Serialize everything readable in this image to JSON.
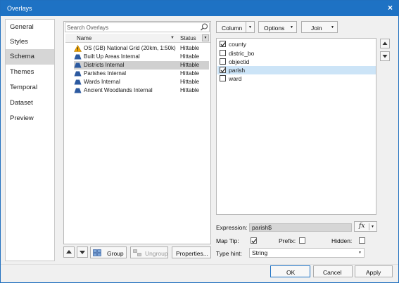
{
  "window": {
    "title": "Overlays",
    "close_glyph": "×"
  },
  "nav": [
    {
      "label": "General",
      "selected": false
    },
    {
      "label": "Styles",
      "selected": false
    },
    {
      "label": "Schema",
      "selected": true
    },
    {
      "label": "Themes",
      "selected": false
    },
    {
      "label": "Temporal",
      "selected": false
    },
    {
      "label": "Dataset",
      "selected": false
    },
    {
      "label": "Preview",
      "selected": false
    }
  ],
  "overlays": {
    "search_placeholder": "Search Overlays",
    "col_name": "Name",
    "col_status": "Status",
    "rows": [
      {
        "name": "OS (GB) National Grid (20km, 1:50k)",
        "status": "Hittable",
        "icon": "warning-icon",
        "selected": false
      },
      {
        "name": "Built Up Areas Internal",
        "status": "Hittable",
        "icon": "layer-icon",
        "selected": false
      },
      {
        "name": "Districts Internal",
        "status": "Hittable",
        "icon": "layer-icon",
        "selected": true
      },
      {
        "name": "Parishes Internal",
        "status": "Hittable",
        "icon": "layer-icon",
        "selected": false
      },
      {
        "name": "Wards Internal",
        "status": "Hittable",
        "icon": "layer-icon",
        "selected": false
      },
      {
        "name": "Ancient Woodlands Internal",
        "status": "Hittable",
        "icon": "layer-icon",
        "selected": false
      }
    ],
    "buttons": {
      "group": "Group",
      "ungroup": "Ungroup",
      "properties": "Properties..."
    }
  },
  "toolbar": {
    "column": "Column",
    "options": "Options",
    "join": "Join"
  },
  "fields": [
    {
      "label": "county",
      "checked": true,
      "selected": false
    },
    {
      "label": "distric_bo",
      "checked": false,
      "selected": false
    },
    {
      "label": "objectid",
      "checked": false,
      "selected": false
    },
    {
      "label": "parish",
      "checked": true,
      "selected": true
    },
    {
      "label": "ward",
      "checked": false,
      "selected": false
    }
  ],
  "expression": {
    "label": "Expression:",
    "value": "parish$",
    "fx": "fx"
  },
  "options_row": {
    "maptip": "Map Tip:",
    "maptip_checked": true,
    "prefix": "Prefix:",
    "prefix_checked": false,
    "hidden": "Hidden:",
    "hidden_checked": false
  },
  "type_hint": {
    "label": "Type hint:",
    "value": "String"
  },
  "footer": {
    "ok": "OK",
    "cancel": "Cancel",
    "apply": "Apply"
  },
  "colors": {
    "title_bar": "#1e72c4",
    "selected_field": "#cce4f7",
    "selected_row": "#d0d0d0",
    "layer_icon": "#2c5aa0",
    "warning_icon": "#f0a500"
  }
}
